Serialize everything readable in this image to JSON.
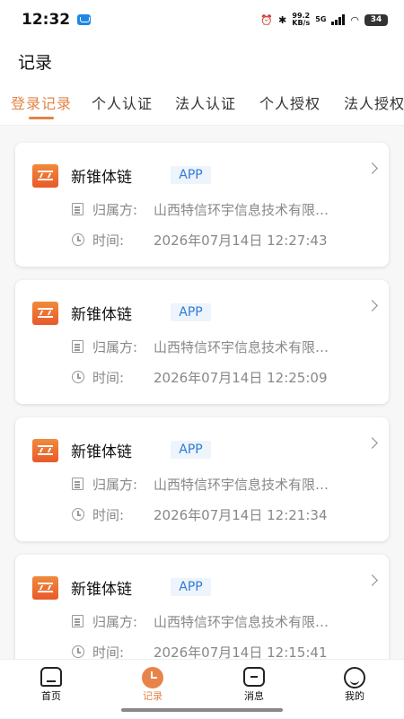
{
  "status_bar": {
    "time": "12:32",
    "net_speed_value": "99.2",
    "net_speed_unit": "KB/s",
    "signal": "5G",
    "battery": "34"
  },
  "header": {
    "title": "记录"
  },
  "tabs": [
    {
      "label": "登录记录",
      "active": true
    },
    {
      "label": "个人认证",
      "active": false
    },
    {
      "label": "法人认证",
      "active": false
    },
    {
      "label": "个人授权",
      "active": false
    },
    {
      "label": "法人授权",
      "active": false
    }
  ],
  "records": [
    {
      "app_name": "新锥体链",
      "badge": "APP",
      "owner_label": "归属方:",
      "owner": "山西特信环宇信息技术有限…",
      "time_label": "时间:",
      "time": "2026年07月14日 12:27:43"
    },
    {
      "app_name": "新锥体链",
      "badge": "APP",
      "owner_label": "归属方:",
      "owner": "山西特信环宇信息技术有限…",
      "time_label": "时间:",
      "time": "2026年07月14日 12:25:09"
    },
    {
      "app_name": "新锥体链",
      "badge": "APP",
      "owner_label": "归属方:",
      "owner": "山西特信环宇信息技术有限…",
      "time_label": "时间:",
      "time": "2026年07月14日 12:21:34"
    },
    {
      "app_name": "新锥体链",
      "badge": "APP",
      "owner_label": "归属方:",
      "owner": "山西特信环宇信息技术有限…",
      "time_label": "时间:",
      "time": "2026年07月14日 12:15:41"
    }
  ],
  "bottom_nav": [
    {
      "label": "首页",
      "icon": "home-icon",
      "active": false
    },
    {
      "label": "记录",
      "icon": "clock-icon",
      "active": true
    },
    {
      "label": "消息",
      "icon": "message-icon",
      "active": false
    },
    {
      "label": "我的",
      "icon": "profile-icon",
      "active": false
    }
  ],
  "colors": {
    "accent": "#e28447",
    "badge_text": "#2f7bd6",
    "badge_bg": "#eef4fb"
  }
}
